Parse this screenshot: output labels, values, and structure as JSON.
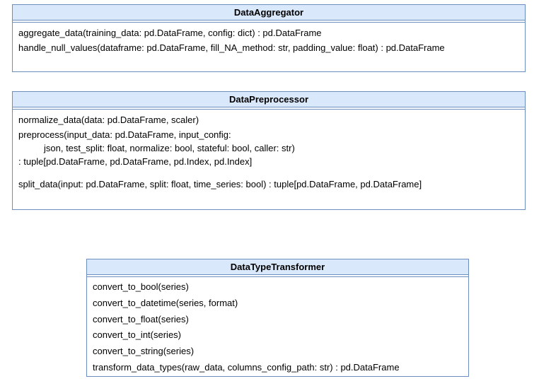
{
  "classes": {
    "data_aggregator": {
      "title": "DataAggregator",
      "methods": [
        "aggregate_data(training_data: pd.DataFrame, config: dict) : pd.DataFrame",
        "handle_null_values(dataframe: pd.DataFrame, fill_NA_method: str, padding_value: float) : pd.DataFrame"
      ]
    },
    "data_preprocessor": {
      "title": "DataPreprocessor",
      "methods": {
        "normalize": "normalize_data(data: pd.DataFrame, scaler)",
        "preprocess_line1": "preprocess(input_data: pd.DataFrame, input_config:",
        "preprocess_line2": "json, test_split: float, normalize: bool, stateful: bool, caller: str)",
        "preprocess_line3": ": tuple[pd.DataFrame, pd.DataFrame, pd.Index, pd.Index]",
        "split": "split_data(input: pd.DataFrame, split: float, time_series: bool) : tuple[pd.DataFrame, pd.DataFrame]"
      }
    },
    "data_type_transformer": {
      "title": "DataTypeTransformer",
      "methods": [
        "convert_to_bool(series)",
        "convert_to_datetime(series, format)",
        "convert_to_float(series)",
        "convert_to_int(series)",
        "convert_to_string(series)",
        "transform_data_types(raw_data, columns_config_path: str) : pd.DataFrame"
      ]
    }
  }
}
